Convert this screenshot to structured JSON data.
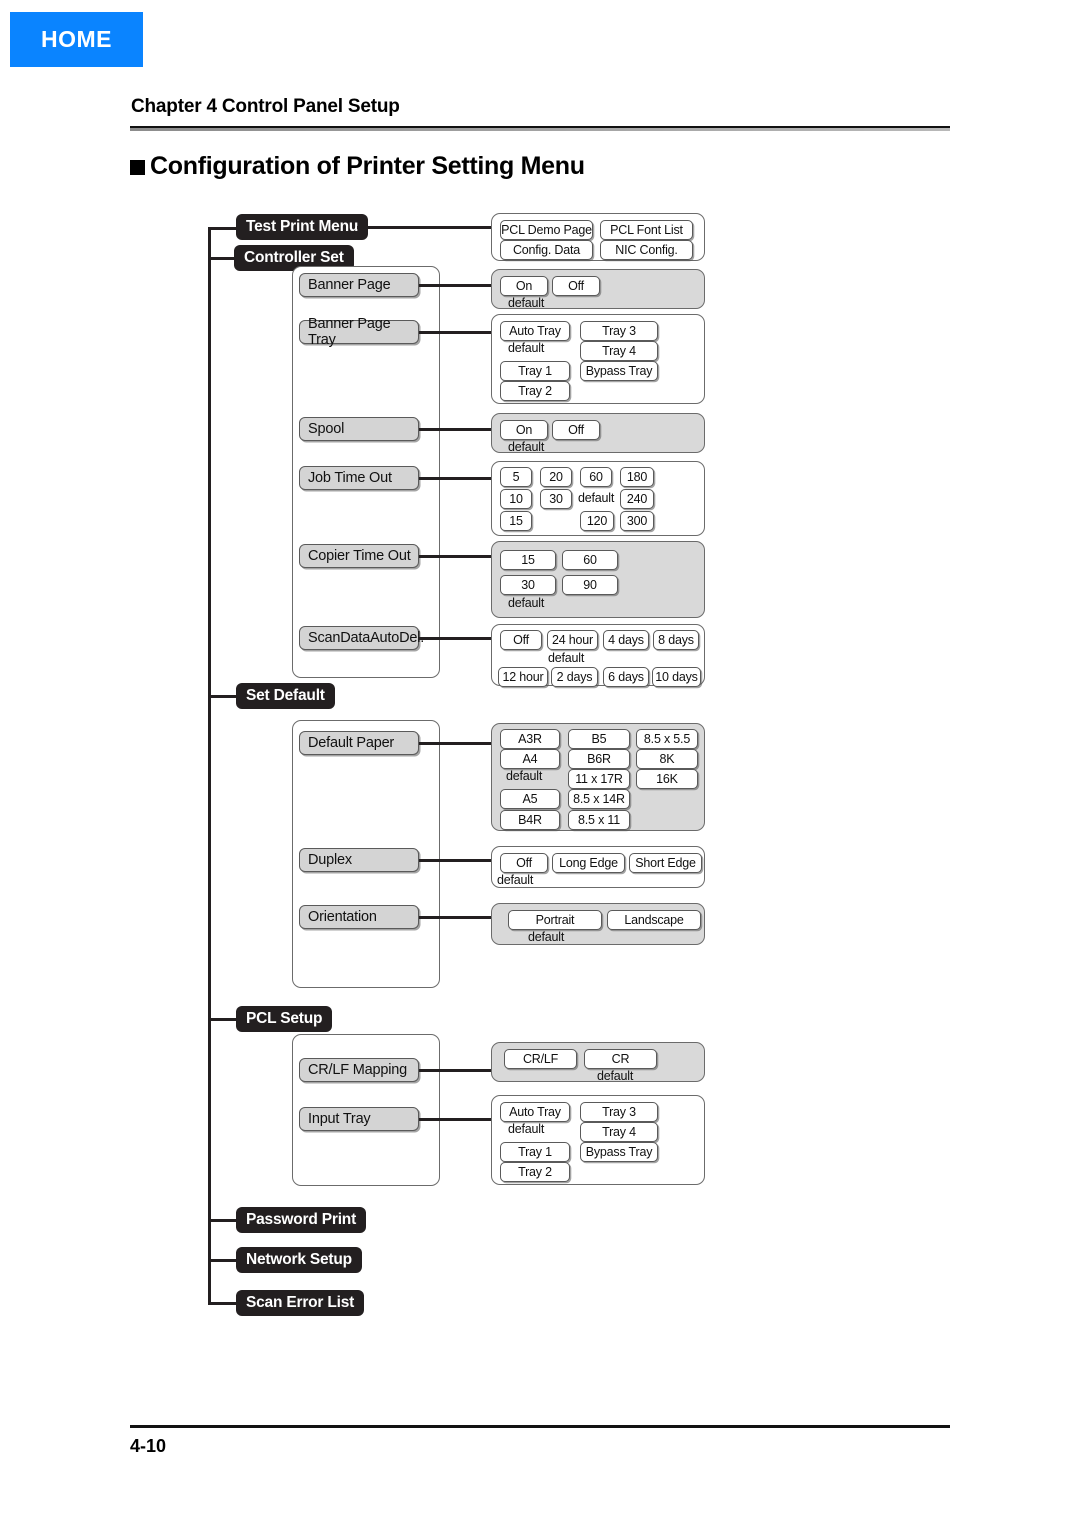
{
  "home_badge": {
    "label": "HOME"
  },
  "header": {
    "chapter": "Chapter 4 Control Panel Setup",
    "title": "Configuration of Printer Setting Menu"
  },
  "footer": {
    "page_number": "4-10"
  },
  "default_label": "default",
  "menu": {
    "root_items": [
      {
        "label": "Test Print Menu"
      },
      {
        "label": "Controller Set"
      },
      {
        "label": "Set Default"
      },
      {
        "label": "PCL Setup"
      },
      {
        "label": "Password Print"
      },
      {
        "label": "Network Setup"
      },
      {
        "label": "Scan Error List"
      }
    ],
    "test_print_menu": {
      "options": [
        "PCL Demo Page",
        "PCL Font List",
        "Config. Data",
        "NIC Config."
      ]
    },
    "controller_set": {
      "items": [
        {
          "label": "Banner Page",
          "options": [
            "On",
            "Off"
          ],
          "default": "On"
        },
        {
          "label": "Banner Page Tray",
          "options": [
            "Auto Tray",
            "Tray 3",
            "Tray 1",
            "Tray 4",
            "Tray 2",
            "Bypass Tray"
          ],
          "default": "Auto Tray"
        },
        {
          "label": "Spool",
          "options": [
            "On",
            "Off"
          ],
          "default": "On"
        },
        {
          "label": "Job Time Out",
          "options": [
            "5",
            "20",
            "60",
            "180",
            "10",
            "30",
            "240",
            "15",
            "120",
            "300"
          ],
          "default": "60"
        },
        {
          "label": "Copier Time Out",
          "options": [
            "15",
            "60",
            "30",
            "90"
          ],
          "default": "30"
        },
        {
          "label": "ScanDataAutoDel.",
          "options": [
            "Off",
            "24 hour",
            "4 days",
            "8 days",
            "12 hour",
            "2 days",
            "6 days",
            "10 days"
          ],
          "default": "24 hour"
        }
      ]
    },
    "set_default": {
      "items": [
        {
          "label": "Default Paper",
          "options": [
            "A3R",
            "B5",
            "8.5 x 5.5",
            "A4",
            "B6R",
            "8K",
            "11 x 17R",
            "16K",
            "A5",
            "8.5 x 14R",
            "B4R",
            "8.5 x 11"
          ],
          "default": "A4"
        },
        {
          "label": "Duplex",
          "options": [
            "Off",
            "Long Edge",
            "Short Edge"
          ],
          "default": "Off"
        },
        {
          "label": "Orientation",
          "options": [
            "Portrait",
            "Landscape"
          ],
          "default": "Portrait"
        }
      ]
    },
    "pcl_setup": {
      "items": [
        {
          "label": "CR/LF Mapping",
          "options": [
            "CR/LF",
            "CR"
          ],
          "default": "CR"
        },
        {
          "label": "Input Tray",
          "options": [
            "Auto Tray",
            "Tray 3",
            "Tray 1",
            "Tray 4",
            "Tray 2",
            "Bypass Tray"
          ],
          "default": "Auto Tray"
        }
      ]
    }
  }
}
